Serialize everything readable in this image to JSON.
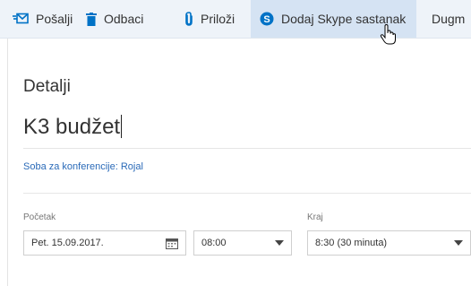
{
  "toolbar": {
    "send_label": "Pošalji",
    "discard_label": "Odbaci",
    "attach_label": "Priloži",
    "skype_label": "Dodaj Skype sastanak",
    "more_label": "Dugm"
  },
  "details": {
    "title": "Detalji",
    "subject": "K3 budžet",
    "room": "Soba za konferencije: Rojal"
  },
  "start": {
    "label": "Početak",
    "date": "Pet. 15.09.2017.",
    "time": "08:00"
  },
  "end": {
    "label": "Kraj",
    "time": "8:30 (30 minuta)"
  },
  "colors": {
    "accent": "#0072c6",
    "toolbar_bg": "#eef3f9",
    "active_bg": "#d5e3f3",
    "skype_blue": "#00a2ed"
  },
  "icons": [
    "send-icon",
    "trash-icon",
    "paperclip-icon",
    "skype-icon",
    "calendar-icon",
    "chevron-down-icon",
    "hand-cursor-icon"
  ]
}
